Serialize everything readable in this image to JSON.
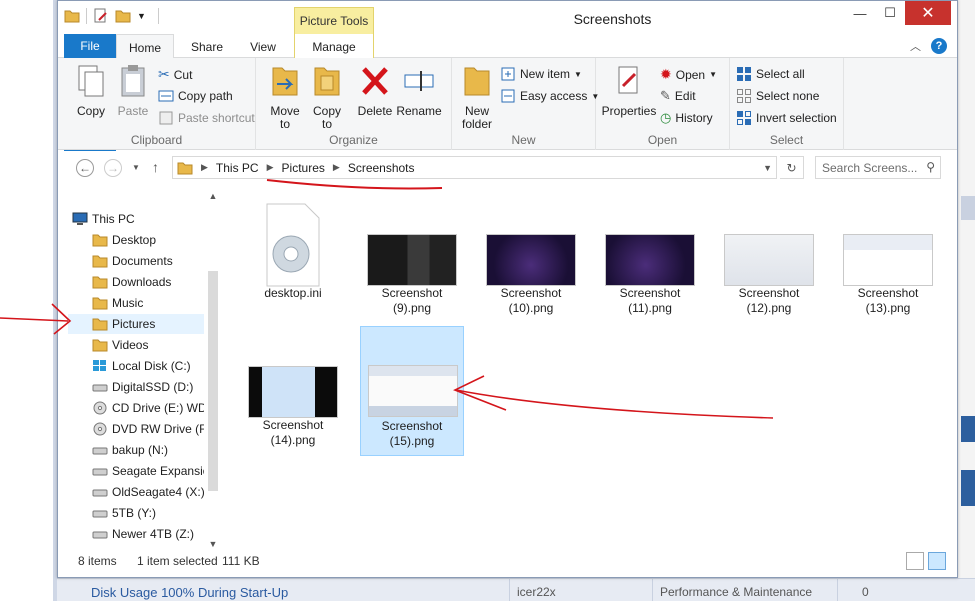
{
  "background": {
    "bottom_row": {
      "topic": "Disk Usage 100% During Start-Up",
      "user": "icer22x",
      "forum": "Performance & Maintenance",
      "count": "0"
    }
  },
  "window": {
    "title": "Screenshots",
    "contextual_tab": "Picture Tools",
    "controls": {
      "minimize": "—",
      "maximize": "☐",
      "close": "✕"
    }
  },
  "tabs": {
    "file": "File",
    "home": "Home",
    "share": "Share",
    "view": "View",
    "manage": "Manage"
  },
  "ribbon": {
    "clipboard": {
      "name": "Clipboard",
      "copy": "Copy",
      "paste": "Paste",
      "cut": "Cut",
      "copy_path": "Copy path",
      "paste_shortcut": "Paste shortcut"
    },
    "organize": {
      "name": "Organize",
      "move_to": [
        "Move",
        "to"
      ],
      "copy_to": [
        "Copy",
        "to"
      ],
      "delete": "Delete",
      "rename": "Rename"
    },
    "new": {
      "name": "New",
      "new_folder": [
        "New",
        "folder"
      ],
      "new_item": "New item",
      "easy_access": "Easy access"
    },
    "open": {
      "name": "Open",
      "properties": "Properties",
      "open": "Open",
      "edit": "Edit",
      "history": "History"
    },
    "select": {
      "name": "Select",
      "select_all": "Select all",
      "select_none": "Select none",
      "invert_selection": "Invert selection"
    }
  },
  "address": {
    "crumbs": [
      "This PC",
      "Pictures",
      "Screenshots"
    ],
    "search_placeholder": "Search Screens..."
  },
  "nav_pane": {
    "items": [
      {
        "label": "This PC",
        "icon": "computer-icon"
      },
      {
        "label": "Desktop",
        "icon": "folder-icon"
      },
      {
        "label": "Documents",
        "icon": "folder-icon"
      },
      {
        "label": "Downloads",
        "icon": "folder-icon"
      },
      {
        "label": "Music",
        "icon": "folder-icon"
      },
      {
        "label": "Pictures",
        "icon": "folder-icon"
      },
      {
        "label": "Videos",
        "icon": "folder-icon"
      },
      {
        "label": "Local Disk (C:)",
        "icon": "windows-drive-icon"
      },
      {
        "label": "DigitalSSD (D:)",
        "icon": "drive-icon"
      },
      {
        "label": "CD Drive (E:) WD",
        "icon": "cd-icon"
      },
      {
        "label": "DVD RW Drive (F:",
        "icon": "cd-icon"
      },
      {
        "label": "bakup (N:)",
        "icon": "drive-icon"
      },
      {
        "label": "Seagate Expansio",
        "icon": "drive-icon"
      },
      {
        "label": "OldSeagate4 (X:)",
        "icon": "drive-icon"
      },
      {
        "label": "5TB (Y:)",
        "icon": "drive-icon"
      },
      {
        "label": "Newer 4TB (Z:)",
        "icon": "drive-icon"
      }
    ]
  },
  "files": [
    {
      "line1": "desktop.ini",
      "line2": ""
    },
    {
      "line1": "Screenshot",
      "line2": "(9).png"
    },
    {
      "line1": "Screenshot",
      "line2": "(10).png"
    },
    {
      "line1": "Screenshot",
      "line2": "(11).png"
    },
    {
      "line1": "Screenshot",
      "line2": "(12).png"
    },
    {
      "line1": "Screenshot",
      "line2": "(13).png"
    },
    {
      "line1": "Screenshot",
      "line2": "(14).png"
    },
    {
      "line1": "Screenshot",
      "line2": "(15).png"
    }
  ],
  "status": {
    "item_count": "8 items",
    "selection": "1 item selected",
    "size": "111 KB"
  },
  "colors": {
    "accent": "#1979ca",
    "annotation": "#d4151b",
    "selection": "#cce8ff"
  }
}
